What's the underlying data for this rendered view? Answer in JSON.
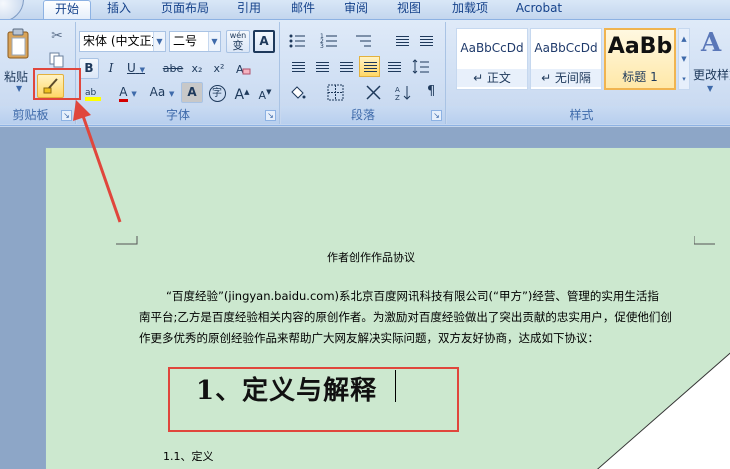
{
  "tabs": [
    "开始",
    "插入",
    "页面布局",
    "引用",
    "邮件",
    "审阅",
    "视图",
    "加载项",
    "Acrobat"
  ],
  "clipboard": {
    "paste_label": "粘贴",
    "group_label": "剪贴板"
  },
  "font": {
    "name_value": "宋体 (中文正文)",
    "size_value": "二号",
    "wen_label": "wén",
    "wen_char": "变",
    "bold": "B",
    "italic": "I",
    "underline": "U",
    "strike": "abe",
    "subscript": "x₂",
    "superscript": "x²",
    "font_color": "A",
    "change_case": "Aa",
    "shade_char": "A",
    "enclose_char": "字",
    "grow": "A",
    "shrink": "A",
    "clear_format": "A",
    "group_label": "字体"
  },
  "paragraph": {
    "group_label": "段落"
  },
  "styles": {
    "items": [
      {
        "sample": "AaBbCcDd",
        "name": "↵ 正文"
      },
      {
        "sample": "AaBbCcDd",
        "name": "↵ 无间隔"
      },
      {
        "sample": "AaBb",
        "name": "标题 1"
      }
    ],
    "change_styles_label": "更改样式",
    "group_label": "样式"
  },
  "document": {
    "title": "作者创作作品协议",
    "lines": [
      "“百度经验”(jingyan.baidu.com)系北京百度网讯科技有限公司(“甲方”)经营、管理的实用生活指",
      "南平台;乙方是百度经验相关内容的原创作者。为激励对百度经验做出了突出贡献的忠实用户，促使他们创",
      "作更多优秀的原创经验作品来帮助广大网友解决实际问题，双方友好协商，达成如下协议："
    ],
    "heading": "1、定义与解释",
    "subitem": "1.1、定义"
  },
  "colors": {
    "annotation": "#e0463c",
    "page_background": "#cce8cf",
    "highlight_yellow": "#ffff00",
    "font_red": "#d40000"
  }
}
